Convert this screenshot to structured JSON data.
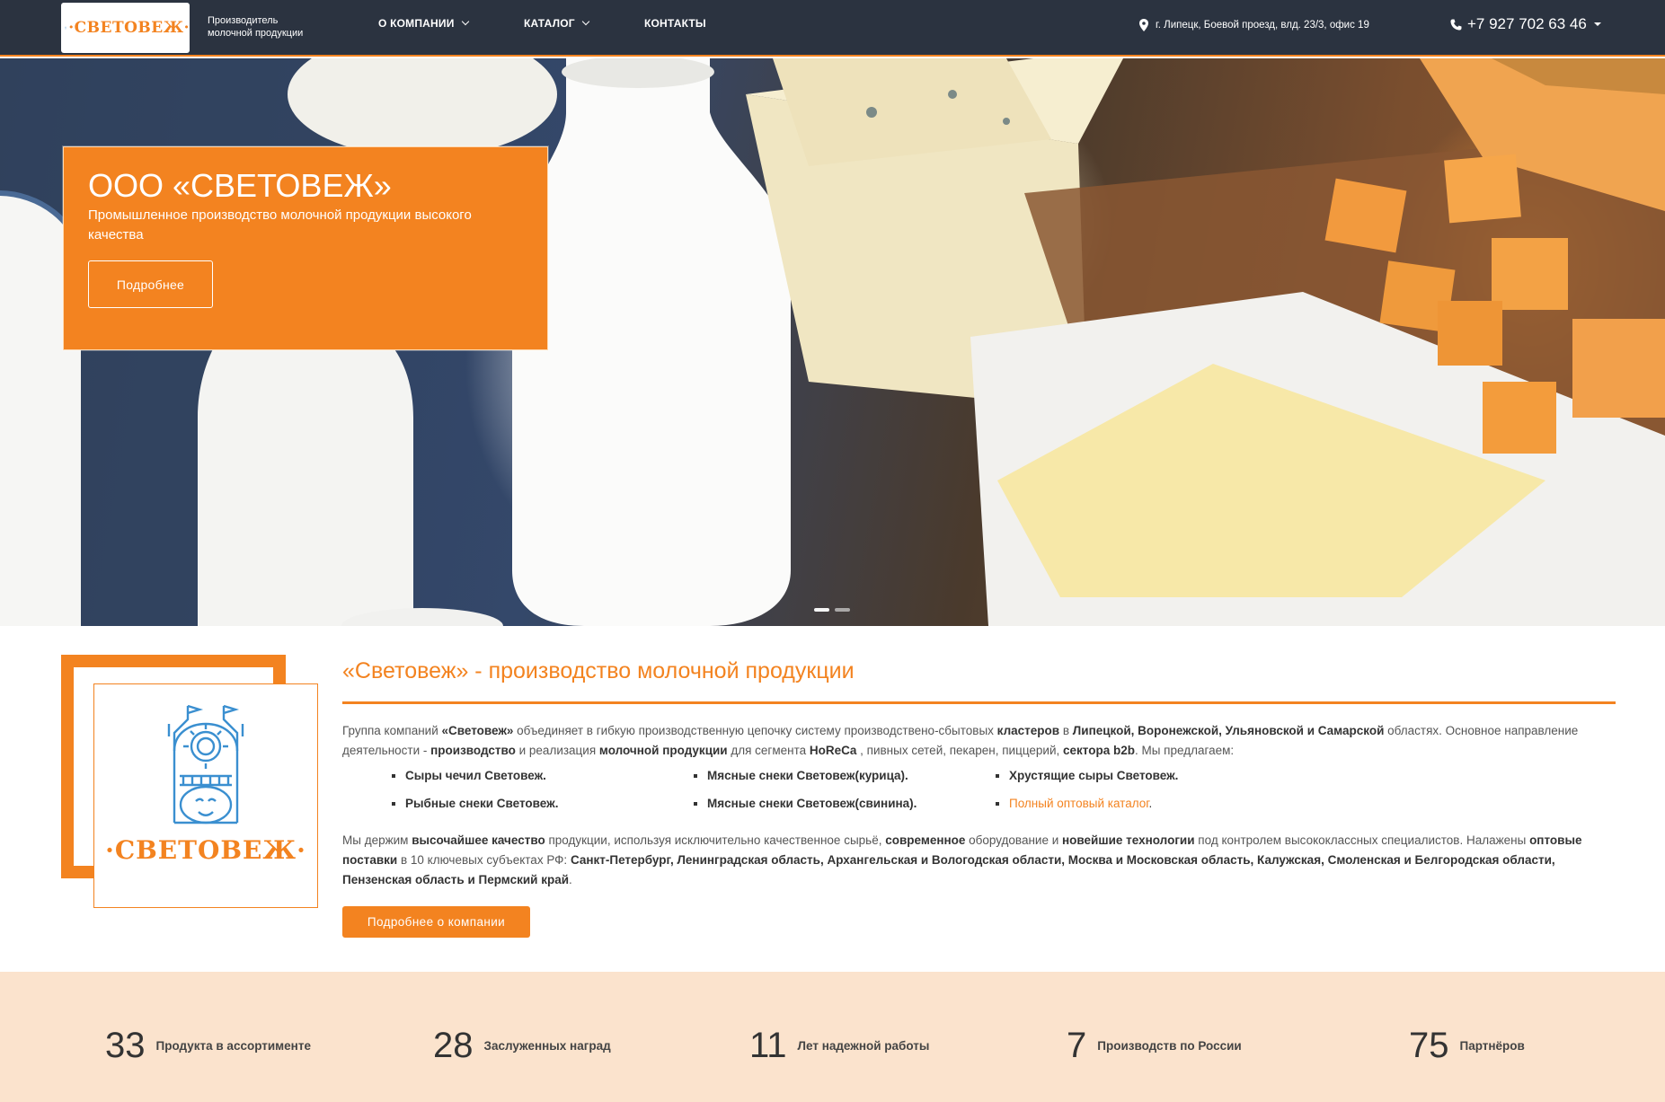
{
  "header": {
    "logo_text": "·СВЕТОВЕЖ·",
    "tagline": "Производитель молочной продукции",
    "nav": [
      {
        "label": "О КОМПАНИИ"
      },
      {
        "label": "КАТАЛОГ"
      },
      {
        "label": "КОНТАКТЫ"
      }
    ],
    "address": "г. Липецк, Боевой проезд, влд. 23/3, офис 19",
    "phone": "+7 927 702 63 46"
  },
  "hero": {
    "title": "ООО «СВЕТОВЕЖ»",
    "subtitle": "Промышленное производство молочной продукции высокого качества",
    "button": "Подробнее",
    "slides": 2,
    "active_slide": 1
  },
  "about": {
    "logo_text": "·СВЕТОВЕЖ·",
    "title": "«Световеж» - производство молочной продукции",
    "p1": {
      "t1": "Группа компаний ",
      "b1": "«Световеж»",
      "t2": " объединяет в гибкую производственную цепочку систему производствено-сбытовых ",
      "b2": "кластеров",
      "t3": " в ",
      "b3": "Липецкой, Воронежской, Ульяновской и Самарской",
      "t4": " областях. Основное направление деятельности - ",
      "b4": "производство",
      "t5": " и реализация ",
      "b5": "молочной продукции",
      "t6": " для сегмента ",
      "b6": "HoReCa",
      "t7": " , пивных сетей, пекарен, пиццерий, ",
      "b7": "сектора b2b",
      "t8": ". Мы предлагаем:"
    },
    "bullets": [
      "Сыры чечил Световеж.",
      "Мясные снеки Световеж(курица).",
      "Хрустящие сыры Световеж.",
      "Рыбные снеки Световеж.",
      "Мясные снеки Световеж(свинина).",
      "Полный оптовый каталог"
    ],
    "p2": {
      "t1": "Мы держим ",
      "b1": "высочайшее качество",
      "t2": " продукции, используя исключительно качественное сырьё, ",
      "b2": "современное",
      "t3": " оборудование и ",
      "b3": "новейшие технологии",
      "t4": " под контролем высококлассных специалистов. Налажены ",
      "b4": "оптовые поставки",
      "t5": " в 10 ключевых субъектах РФ: ",
      "b5": "Санкт-Петербург, Ленинградская область, Архангельская и Вологодская области, Москва и Московская область, Калужская, Смоленская и Белгородская области, Пензенская область и Пермский край",
      "t6": "."
    },
    "button": "Подробнее о компании"
  },
  "stats": [
    {
      "value": "33",
      "label": "Продукта в ассортименте"
    },
    {
      "value": "28",
      "label": "Заслуженных наград"
    },
    {
      "value": "11",
      "label": "Лет надежной работы"
    },
    {
      "value": "7",
      "label": "Производств по России"
    },
    {
      "value": "75",
      "label": "Партнёров"
    }
  ],
  "colors": {
    "accent": "#f38320",
    "header_bg": "#2b3340",
    "stats_bg": "#fbe3cd"
  },
  "icons": [
    "map-pin-icon",
    "phone-icon",
    "chevron-down-icon",
    "castle-logo-icon"
  ]
}
